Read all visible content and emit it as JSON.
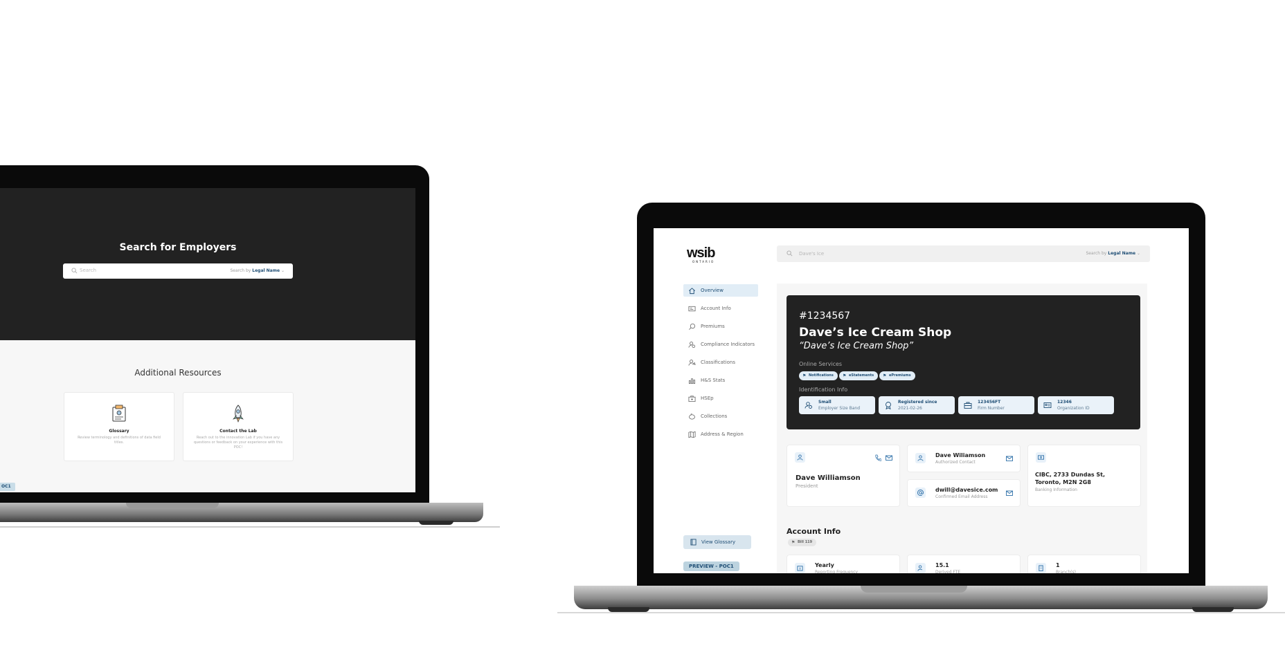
{
  "left_app": {
    "hero_title": "Search for Employers",
    "search": {
      "placeholder": "Search",
      "search_by_label": "Search by",
      "search_by_value": "Legal Name"
    },
    "resources_title": "Additional Resources",
    "cards": [
      {
        "title": "Glossary",
        "description": "Review terminology and definitions of data field titles."
      },
      {
        "title": "Contact the Lab",
        "description": "Reach out to the innovation Lab if you have any questions or feedback on your experience with this POC!"
      }
    ],
    "badge": "OC1"
  },
  "right_app": {
    "logo": "wsib",
    "logo_sub": "ONTARIO",
    "search": {
      "value": "Dave's Ice",
      "search_by_label": "Search by",
      "search_by_value": "Legal Name"
    },
    "nav": [
      {
        "label": "Overview",
        "icon": "home-icon",
        "active": true
      },
      {
        "label": "Account Info",
        "icon": "id-card-icon",
        "active": false
      },
      {
        "label": "Premiums",
        "icon": "dollar-search-icon",
        "active": false
      },
      {
        "label": "Compliance Indicators",
        "icon": "user-check-icon",
        "active": false
      },
      {
        "label": "Classifications",
        "icon": "user-tag-icon",
        "active": false
      },
      {
        "label": "H&S Stats",
        "icon": "chart-icon",
        "active": false
      },
      {
        "label": "HSEp",
        "icon": "medkit-icon",
        "active": false
      },
      {
        "label": "Collections",
        "icon": "piggy-bank-icon",
        "active": false
      },
      {
        "label": "Address & Region",
        "icon": "map-icon",
        "active": false
      }
    ],
    "glossary_button": "View Glossary",
    "preview_badge": "PREVIEW - POC1",
    "hero": {
      "number": "#1234567",
      "name": "Dave’s Ice Cream Shop",
      "dba": "“Dave’s Ice Cream Shop”",
      "online_services_label": "Online Services",
      "online_services": [
        "Notifications",
        "eStatements",
        "ePremiums"
      ],
      "identification_label": "Identification Info",
      "identification": [
        {
          "value": "Small",
          "key": "Employer Size Band",
          "icon": "user-settings-icon"
        },
        {
          "value": "Registered since",
          "key": "2021-02-26",
          "icon": "badge-icon"
        },
        {
          "value": "123456FT",
          "key": "Firm Number",
          "icon": "briefcase-icon"
        },
        {
          "value": "12346",
          "key": "Organization ID",
          "icon": "id-card-icon"
        }
      ]
    },
    "contacts": {
      "president": {
        "name": "Dave Williamson",
        "role": "President"
      },
      "authorized": {
        "name": "Dave Wiliamson",
        "role": "Authorized Contact"
      },
      "email": {
        "value": "dwill@davesice.com",
        "role": "Confirmed Email Address"
      },
      "bank": {
        "line1": "CIBC, 2733 Dundas St,",
        "line2": "Toronto, M2N 2G8",
        "role": "Banking Information"
      }
    },
    "account_info": {
      "title": "Account Info",
      "chip": "Bill 119",
      "stats": [
        {
          "value": "Yearly",
          "key": "Reporting Frequency"
        },
        {
          "value": "15.1",
          "key": "Derived FTE"
        },
        {
          "value": "1",
          "key": "Branch(s)"
        }
      ]
    },
    "accent_color": "#1e4d74"
  }
}
